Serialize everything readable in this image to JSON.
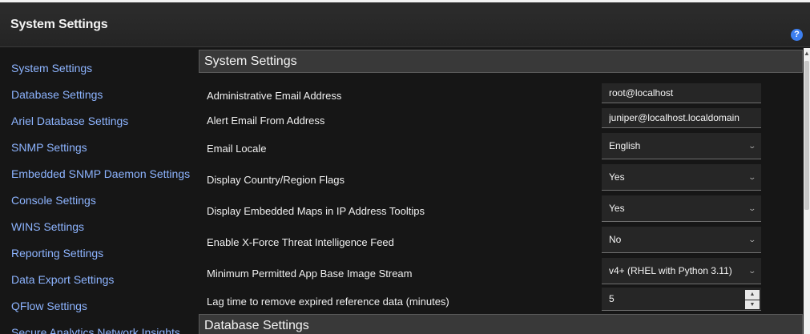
{
  "header": {
    "title": "System Settings",
    "help_icon": "?"
  },
  "sidebar": {
    "items": [
      "System Settings",
      "Database Settings",
      "Ariel Database Settings",
      "SNMP Settings",
      "Embedded SNMP Daemon Settings",
      "Console Settings",
      "WINS Settings",
      "Reporting Settings",
      "Data Export Settings",
      "QFlow Settings",
      "Secure Analytics Network Insights"
    ]
  },
  "main": {
    "section_title": "System Settings",
    "next_section_title": "Database Settings",
    "rows": [
      {
        "label": "Administrative Email Address",
        "value": "root@localhost"
      },
      {
        "label": "Alert Email From Address",
        "value": "juniper@localhost.localdomain"
      },
      {
        "label": "Email Locale",
        "value": "English"
      },
      {
        "label": "Display Country/Region Flags",
        "value": "Yes"
      },
      {
        "label": "Display Embedded Maps in IP Address Tooltips",
        "value": "Yes"
      },
      {
        "label": "Enable X-Force Threat Intelligence Feed",
        "value": "No"
      },
      {
        "label": "Minimum Permitted App Base Image Stream",
        "value": "v4+ (RHEL with Python 3.11)"
      },
      {
        "label": "Lag time to remove expired reference data (minutes)",
        "value": "5"
      }
    ]
  },
  "icons": {
    "chevron": "⌄",
    "up": "▲",
    "down": "▼",
    "scroll_up": "▲"
  },
  "colors": {
    "background": "#161616",
    "link": "#8db4ff",
    "help": "#3d7ff0",
    "section_header": "#393939"
  }
}
